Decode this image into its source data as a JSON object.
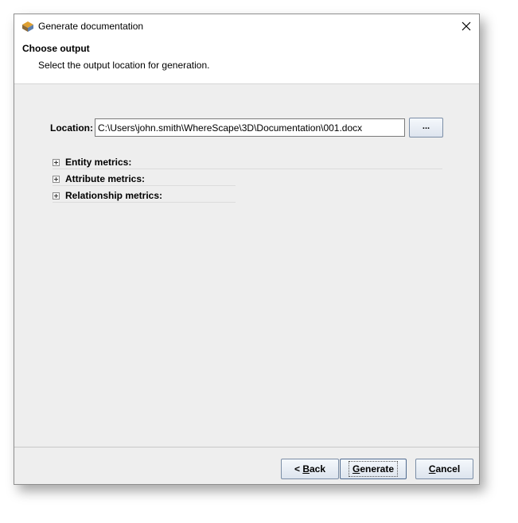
{
  "window": {
    "title": "Generate documentation"
  },
  "header": {
    "title": "Choose output",
    "subtitle": "Select the output location for generation."
  },
  "location": {
    "label": "Location:",
    "value": "C:\\Users\\john.smith\\WhereScape\\3D\\Documentation\\001.docx",
    "browse_label": "..."
  },
  "tree": {
    "items": [
      {
        "label": "Entity metrics:"
      },
      {
        "label": "Attribute metrics:"
      },
      {
        "label": "Relationship metrics:"
      }
    ]
  },
  "footer": {
    "back_prefix": "< ",
    "back_mnemonic": "B",
    "back_rest": "ack",
    "generate_mnemonic": "G",
    "generate_rest": "enerate",
    "cancel_mnemonic": "C",
    "cancel_rest": "ancel"
  },
  "colors": {
    "window_bg": "#eeeeee",
    "header_bg": "#ffffff",
    "button_border": "#7b8ea6"
  }
}
